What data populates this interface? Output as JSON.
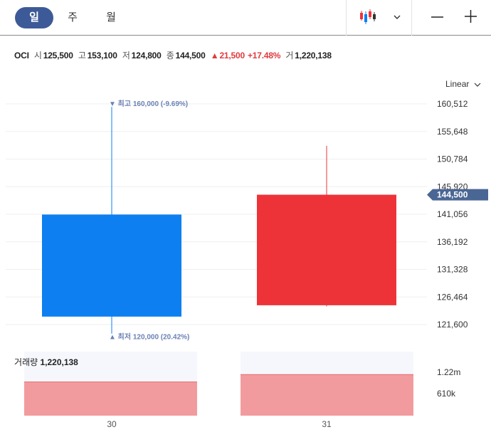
{
  "toolbar": {
    "periods": [
      {
        "label": "일",
        "active": true
      },
      {
        "label": "주",
        "active": false
      },
      {
        "label": "월",
        "active": false
      }
    ],
    "chart_type_icon": "candlestick-icon",
    "dropdown_icon": "chevron-down-icon",
    "zoom_out_icon": "minus-icon",
    "zoom_in_icon": "plus-icon"
  },
  "quote": {
    "symbol": "OCI",
    "open_label": "시",
    "open": "125,500",
    "high_label": "고",
    "high": "153,100",
    "low_label": "저",
    "low": "124,800",
    "close_label": "종",
    "close": "144,500",
    "change_arrow": "▲",
    "change": "21,500",
    "change_pct": "+17.48%",
    "volume_label": "거",
    "volume": "1,220,138"
  },
  "scale_mode": "Linear",
  "volume_header": {
    "label": "거래량",
    "value": "1,220,138"
  },
  "colors": {
    "up": "#ee3338",
    "down": "#0d7ff0",
    "volume_fill": "#f29b9e",
    "volume_bg": "#f5f7fc",
    "price_tag_bg": "#4a6694",
    "annotation": "#6b82b5"
  },
  "chart_data": {
    "type": "candlestick",
    "categories": [
      "30",
      "31"
    ],
    "candles": [
      {
        "open": 141000,
        "high": 160000,
        "low": 120000,
        "close": 123000
      },
      {
        "open": 125000,
        "high": 153100,
        "low": 124800,
        "close": 144500
      }
    ],
    "y_ticks": [
      "160,512",
      "155,648",
      "150,784",
      "145,920",
      "141,056",
      "136,192",
      "131,328",
      "126,464",
      "121,600"
    ],
    "ylim": [
      121600,
      160512
    ],
    "last_price_label": "144,500",
    "last_price": 144500,
    "annotations": [
      {
        "marker": "▼",
        "text": "최고 160,000 (-9.69%)",
        "price": 160000,
        "position": "above"
      },
      {
        "marker": "▲",
        "text": "최저 120,000 (20.42%)",
        "price": 120000,
        "position": "below"
      }
    ],
    "volume": {
      "values": [
        1000000,
        1220138
      ],
      "y_ticks": [
        {
          "label": "1.22m",
          "value": 1220138
        },
        {
          "label": "610k",
          "value": 610000
        }
      ],
      "ylim": [
        0,
        1900000
      ]
    },
    "grid": true
  }
}
